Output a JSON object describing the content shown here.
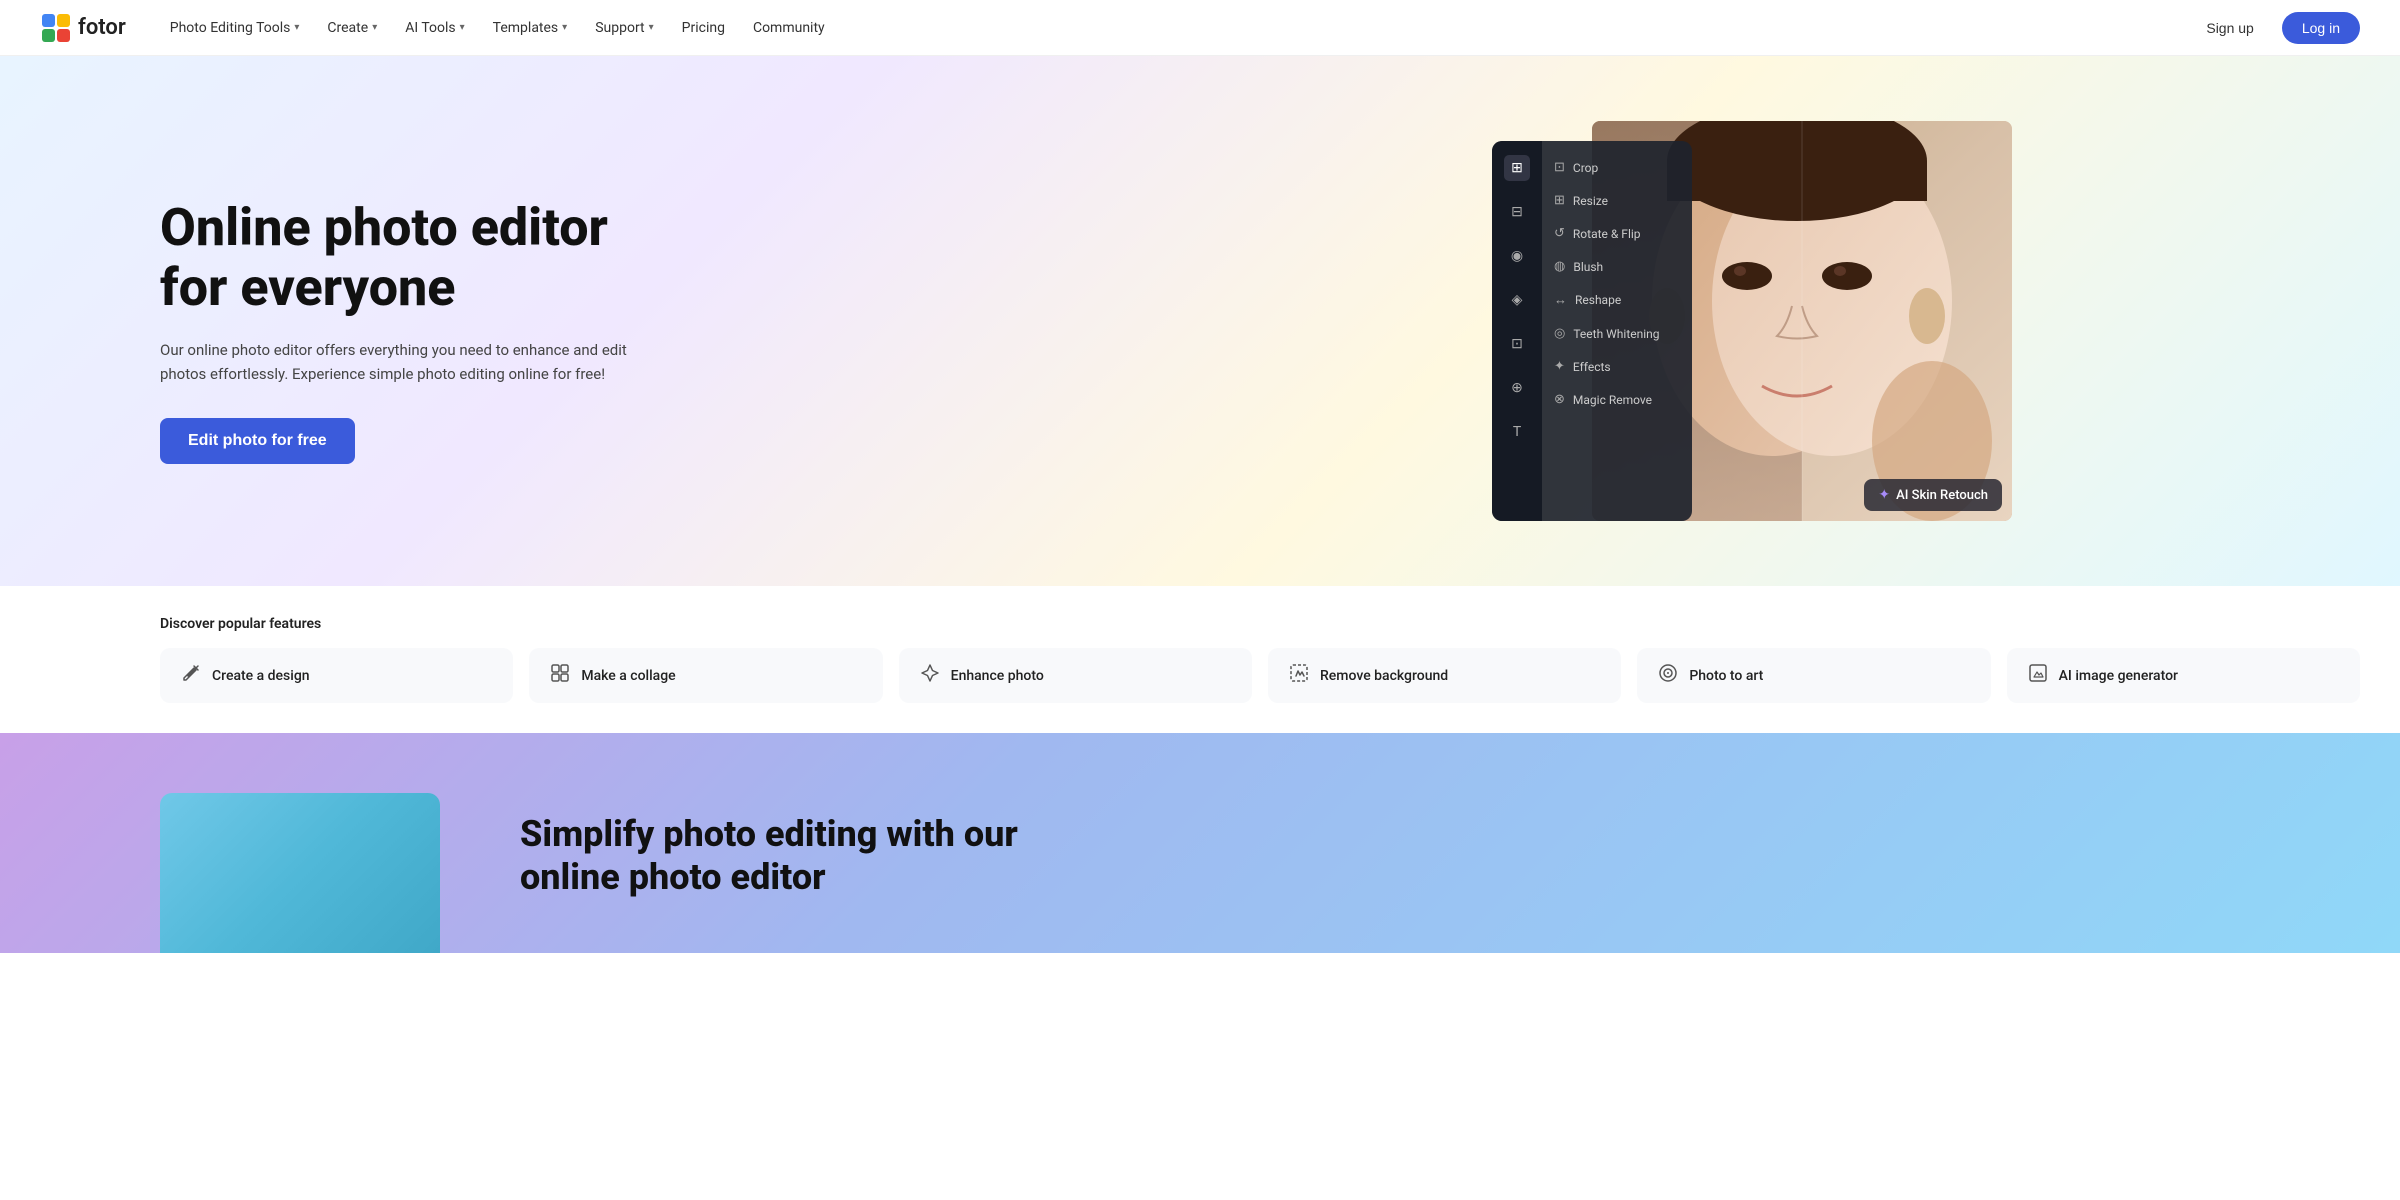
{
  "brand": {
    "name": "fotor",
    "logo_icon": "🎨"
  },
  "navbar": {
    "items": [
      {
        "id": "photo-editing-tools",
        "label": "Photo Editing Tools",
        "has_dropdown": true
      },
      {
        "id": "create",
        "label": "Create",
        "has_dropdown": true
      },
      {
        "id": "ai-tools",
        "label": "AI Tools",
        "has_dropdown": true
      },
      {
        "id": "templates",
        "label": "Templates",
        "has_dropdown": true
      },
      {
        "id": "support",
        "label": "Support",
        "has_dropdown": true
      },
      {
        "id": "pricing",
        "label": "Pricing",
        "has_dropdown": false
      },
      {
        "id": "community",
        "label": "Community",
        "has_dropdown": false
      }
    ],
    "signup_label": "Sign up",
    "login_label": "Log in"
  },
  "hero": {
    "title": "Online photo editor for everyone",
    "subtitle": "Our online photo editor offers everything you need to enhance and edit photos effortlessly. Experience simple photo editing online for free!",
    "cta_label": "Edit photo for free"
  },
  "editor_panel": {
    "menu_items": [
      {
        "icon": "⊡",
        "label": "Crop"
      },
      {
        "icon": "⊞",
        "label": "Resize"
      },
      {
        "icon": "↺",
        "label": "Rotate & Flip"
      },
      {
        "icon": "💄",
        "label": "Blush"
      },
      {
        "icon": "↔",
        "label": "Reshape"
      },
      {
        "icon": "🦷",
        "label": "Teeth Whitening"
      },
      {
        "icon": "✨",
        "label": "Effects"
      },
      {
        "icon": "⊗",
        "label": "Magic Remove"
      }
    ],
    "ai_badge_label": "AI Skin Retouch"
  },
  "features": {
    "section_label": "Discover popular features",
    "items": [
      {
        "id": "create-design",
        "icon": "✂",
        "label": "Create a design"
      },
      {
        "id": "make-collage",
        "icon": "⊞",
        "label": "Make a collage"
      },
      {
        "id": "enhance-photo",
        "icon": "⚡",
        "label": "Enhance photo"
      },
      {
        "id": "remove-background",
        "icon": "◱",
        "label": "Remove background"
      },
      {
        "id": "photo-to-art",
        "icon": "◎",
        "label": "Photo to art"
      },
      {
        "id": "ai-image-generator",
        "icon": "⊡",
        "label": "AI image generator"
      }
    ]
  },
  "bottom": {
    "title": "Simplify photo editing with our online photo editor"
  }
}
